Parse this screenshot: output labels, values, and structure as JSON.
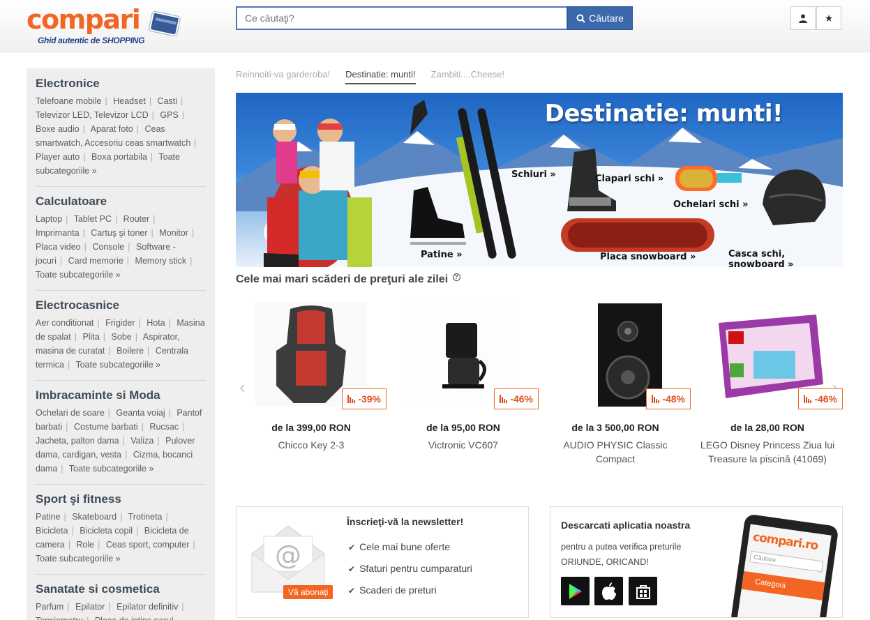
{
  "header": {
    "logo_text": "compari",
    "logo_tagline": "Ghid autentic de SHOPPING",
    "search_placeholder": "Ce căutaţi?",
    "search_button": "Căutare"
  },
  "sidebar": {
    "categories": [
      {
        "title": "Electronice",
        "links": [
          "Telefoane mobile",
          "Headset",
          "Casti",
          "Televizor LED, Televizor LCD",
          "GPS",
          "Boxe audio",
          "Aparat foto",
          "Ceas smartwatch, Accesoriu ceas smartwatch",
          "Player auto",
          "Boxa portabila",
          "Toate subcategoriile »"
        ]
      },
      {
        "title": "Calculatoare",
        "links": [
          "Laptop",
          "Tablet PC",
          "Router",
          "Imprimanta",
          "Cartuş şi toner",
          "Monitor",
          "Placa video",
          "Console",
          "Software - jocuri",
          "Card memorie",
          "Memory stick",
          "Toate subcategoriile »"
        ]
      },
      {
        "title": "Electrocasnice",
        "links": [
          "Aer conditionat",
          "Frigider",
          "Hota",
          "Masina de spalat",
          "Plita",
          "Sobe",
          "Aspirator, masina de curatat",
          "Boilere",
          "Centrala termica",
          "Toate subcategoriile »"
        ]
      },
      {
        "title": "Imbracaminte si Moda",
        "links": [
          "Ochelari de soare",
          "Geanta voiaj",
          "Pantof barbati",
          "Costume barbati",
          "Rucsac",
          "Jacheta, palton dama",
          "Valiza",
          "Pulover dama, cardigan, vesta",
          "Cizma, bocanci dama",
          "Toate subcategoriile »"
        ]
      },
      {
        "title": "Sport şi fitness",
        "links": [
          "Patine",
          "Skateboard",
          "Trotineta",
          "Bicicleta",
          "Bicicleta copil",
          "Bicicleta de camera",
          "Role",
          "Ceas sport, computer",
          "Toate subcategoriile »"
        ]
      },
      {
        "title": "Sanatate si cosmetica",
        "links": [
          "Parfum",
          "Epilator",
          "Epilator definitiv",
          "Tensiometru",
          "Placa de intins parul"
        ]
      }
    ]
  },
  "tabs": [
    "Reinnoiti-va garderoba!",
    "Destinatie: munti!",
    "Zambiti....Cheese!"
  ],
  "banner": {
    "title": "Destinatie: munti!",
    "labels": {
      "schiuri": "Schiuri »",
      "clapari": "Clapari schi »",
      "ochelari": "Ochelari schi »",
      "patine": "Patine »",
      "placa": "Placa snowboard »",
      "casca": "Casca schi, snowboard »"
    }
  },
  "deals": {
    "title": "Cele mai mari scăderi de preţuri ale zilei",
    "info_icon": "?",
    "products": [
      {
        "price": "de la 399,00 RON",
        "name": "Chicco Key 2-3",
        "discount": "-39%"
      },
      {
        "price": "de la 95,00 RON",
        "name": "Victronic VC607",
        "discount": "-46%"
      },
      {
        "price": "de la 3 500,00 RON",
        "name": "AUDIO PHYSIC Classic Compact",
        "discount": "-48%"
      },
      {
        "price": "de la 28,00 RON",
        "name": "LEGO Disney Princess Ziua lui Treasure la piscină (41069)",
        "discount": "-46%"
      }
    ]
  },
  "newsletter": {
    "title": "Înscrieţi-vă la newsletter!",
    "items": [
      "Cele mai bune oferte",
      "Sfaturi pentru cumparaturi",
      "Scaderi de preturi"
    ],
    "button": "Vă abonaţi"
  },
  "app": {
    "title": "Descarcati aplicatia noastra",
    "line1": "pentru a putea verifica preturile",
    "line2": "ORIUNDE, ORICAND!",
    "phone_logo": "compari.ro",
    "phone_search": "Căutare",
    "phone_menu": "Categorii"
  }
}
